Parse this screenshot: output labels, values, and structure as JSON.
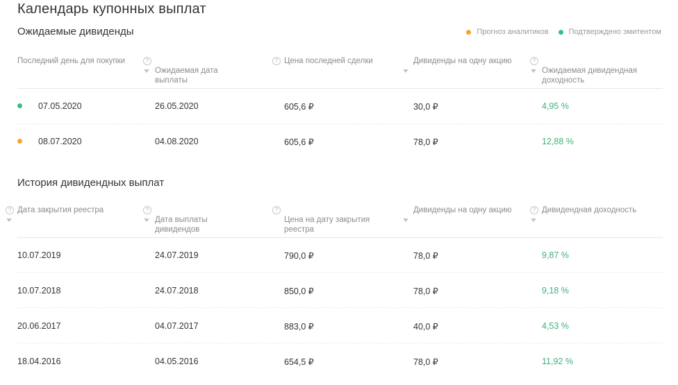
{
  "title": "Календарь купонных выплат",
  "colors": {
    "forecast": "#f5a623",
    "confirmed": "#33c17e",
    "yield": "#3fb07d"
  },
  "expected": {
    "title": "Ожидаемые дивиденды",
    "legend": [
      {
        "label": "Прогноз аналитиков",
        "status": "forecast"
      },
      {
        "label": "Подтверждено эмитентом",
        "status": "confirmed"
      }
    ],
    "headers": [
      {
        "label": "Последний день для покупки",
        "help": false
      },
      {
        "label": "Ожидаемая дата\nвыплаты",
        "help": true
      },
      {
        "label": "Цена последней сделки",
        "help": true
      },
      {
        "label": "Дивиденды на одну акцию",
        "help": false
      },
      {
        "label": "Ожидаемая дивидендная\nдоходность",
        "help": true
      }
    ],
    "rows": [
      {
        "status": "confirmed",
        "cells": [
          "07.05.2020",
          "26.05.2020",
          "605,6 ₽",
          "30,0 ₽",
          "4,95 %"
        ]
      },
      {
        "status": "forecast",
        "cells": [
          "08.07.2020",
          "04.08.2020",
          "605,6 ₽",
          "78,0 ₽",
          "12,88 %"
        ]
      }
    ]
  },
  "history": {
    "title": "История дивидендных выплат",
    "headers": [
      {
        "label": "Дата закрытия реестра",
        "help": true
      },
      {
        "label": "Дата выплаты\nдивидендов",
        "help": true
      },
      {
        "label": "Цена на дату закрытия\nреестра",
        "help": true
      },
      {
        "label": "Дивиденды на одну акцию",
        "help": false
      },
      {
        "label": "Дивидендная доходность",
        "help": true
      }
    ],
    "rows": [
      [
        "10.07.2019",
        "24.07.2019",
        "790,0 ₽",
        "78,0 ₽",
        "9,87 %"
      ],
      [
        "10.07.2018",
        "24.07.2018",
        "850,0 ₽",
        "78,0 ₽",
        "9,18 %"
      ],
      [
        "20.06.2017",
        "04.07.2017",
        "883,0 ₽",
        "40,0 ₽",
        "4,53 %"
      ],
      [
        "18.04.2016",
        "04.05.2016",
        "654,5 ₽",
        "78,0 ₽",
        "11,92 %"
      ]
    ]
  }
}
